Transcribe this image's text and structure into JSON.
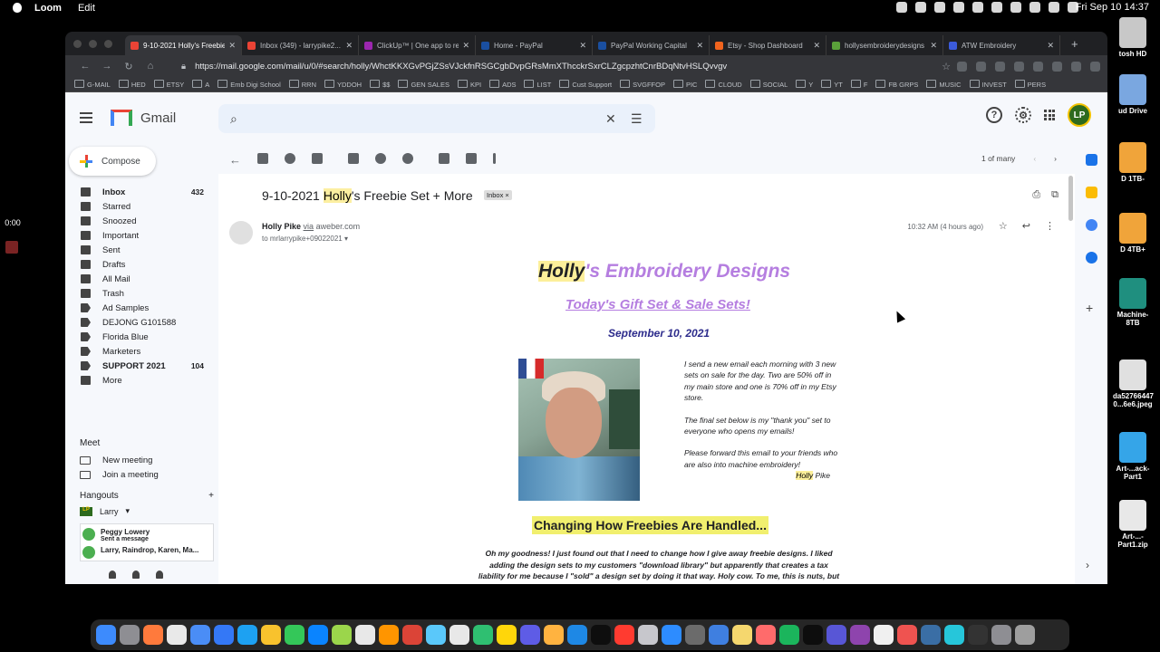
{
  "menubar": {
    "app": "Loom",
    "menu_edit": "Edit",
    "clock": "Fri Sep 10  14:37"
  },
  "loom": {
    "timer": "0:00"
  },
  "desktop_icons": [
    {
      "label": "tosh HD",
      "color": "#c8c8c8"
    },
    {
      "label": "ud Drive",
      "color": "#7aa7e0"
    },
    {
      "label": "D 1TB-",
      "color": "#f0a43a"
    },
    {
      "label": "D 4TB+",
      "color": "#f0a43a"
    },
    {
      "label": "Machine-8TB",
      "color": "#1f8f7f"
    },
    {
      "label": "da52766447 0...6e6.jpeg",
      "color": "#e0e0e0"
    },
    {
      "label": "Art-...ack-Part1",
      "color": "#35a5e8"
    },
    {
      "label": "Art-...-Part1.zip",
      "color": "#e8e8e8"
    }
  ],
  "browser": {
    "tabs": [
      {
        "title": "9-10-2021 Holly's Freebie",
        "color": "#ea4335",
        "active": true
      },
      {
        "title": "Inbox (349) - larrypike2...",
        "color": "#ea4335"
      },
      {
        "title": "ClickUp™ | One app to rep",
        "color": "#9c27b0"
      },
      {
        "title": "Home - PayPal",
        "color": "#1a4fa0"
      },
      {
        "title": "PayPal Working Capital",
        "color": "#1a4fa0"
      },
      {
        "title": "Etsy - Shop Dashboard",
        "color": "#f1641e"
      },
      {
        "title": "hollysembroiderydesigns",
        "color": "#5aa03a"
      },
      {
        "title": "ATW Embroidery",
        "color": "#3b5bdb"
      }
    ],
    "new_tab": "+",
    "url": "https://mail.google.com/mail/u/0/#search/holly/WhctKKXGvPGjZSsVJckfnRSGCgbDvpGRsMmXThcckrSxrCLZgcpzhtCnrBDqNtvHSLQvvgv",
    "bookmarks": [
      "G-MAIL",
      "HED",
      "ETSY",
      "A",
      "Emb Digi School",
      "RRN",
      "YDDOH",
      "$$",
      "GEN SALES",
      "KPI",
      "ADS",
      "LIST",
      "Cust Support",
      "SVGFFOP",
      "PIC",
      "CLOUD",
      "SOCIAL",
      "Y",
      "YT",
      "F",
      "FB GRPS",
      "MUSIC",
      "INVEST",
      "PERS"
    ]
  },
  "gmail": {
    "product": "Gmail",
    "search_value": "",
    "avatar_initials": "LP",
    "compose": "Compose",
    "nav": [
      {
        "label": "Inbox",
        "count": "432",
        "bold": true,
        "icon": "inbox-icon"
      },
      {
        "label": "Starred",
        "icon": "star-icon"
      },
      {
        "label": "Snoozed",
        "icon": "clock-icon"
      },
      {
        "label": "Important",
        "icon": "important-icon"
      },
      {
        "label": "Sent",
        "icon": "send-icon"
      },
      {
        "label": "Drafts",
        "icon": "draft-icon"
      },
      {
        "label": "All Mail",
        "icon": "all-mail-icon"
      },
      {
        "label": "Trash",
        "icon": "trash-icon"
      },
      {
        "label": "Ad Samples",
        "icon": "label-icon"
      },
      {
        "label": "DEJONG G101588",
        "icon": "label-icon"
      },
      {
        "label": "Florida Blue",
        "icon": "label-icon"
      },
      {
        "label": "Marketers",
        "icon": "label-icon"
      },
      {
        "label": "SUPPORT 2021",
        "count": "104",
        "bold": true,
        "icon": "label-icon"
      },
      {
        "label": "More",
        "icon": "chevron-down-icon"
      }
    ],
    "meet": {
      "title": "Meet",
      "new_meeting": "New meeting",
      "join_meeting": "Join a meeting"
    },
    "hangouts": {
      "title": "Hangouts",
      "me": "Larry",
      "contacts": [
        {
          "name": "Peggy Lowery",
          "status": "Sent a message"
        },
        {
          "name": "Larry, Raindrop, Karen, Ma...",
          "status": ""
        }
      ]
    },
    "pager": "1 of many",
    "message": {
      "subject_pre": "9-10-2021 ",
      "subject_hl": "Holly",
      "subject_post": "'s Freebie Set + More",
      "label_chip": "Inbox ×",
      "sender_name": "Holly Pike",
      "sender_via": "via",
      "sender_domain": "aweber.com",
      "to": "to mrlarrypike+09022021",
      "time": "10:32 AM (4 hours ago)",
      "body": {
        "title_hl": "Holly",
        "title_rest": "'s Embroidery Designs",
        "subtitle": "Today's Gift Set & Sale Sets!",
        "date": "September 10, 2021",
        "intro_1": "I send a new email each morning with 3 new sets on sale for the day.  Two are 50% off in my main store and one is 70% off in my Etsy store.",
        "intro_2": "The final set below is my \"thank you\" set to everyone who opens my emails!",
        "intro_3": "Please forward this email to your friends who are also into machine embroidery!",
        "sig_hl": "Holly",
        "sig_rest": " Pike",
        "heading": "Changing How Freebies Are Handled...",
        "para": "Oh my goodness!  I just found out that I need to change how I give away freebie designs.  I liked adding the design sets to my customers \"download library\" but apparently that creates a tax liability for me because I \"sold\" a design set by doing it that way.  Holy cow.  To me, this is nuts, but I don't get to run the world."
      }
    }
  },
  "dock_colors": [
    "#3d8bfd",
    "#8e8e93",
    "#ff7a3c",
    "#e9e9e9",
    "#4a8df6",
    "#3478f6",
    "#1da1f2",
    "#f8c22d",
    "#34c759",
    "#0a84ff",
    "#9bd64b",
    "#e8e8e8",
    "#ff9500",
    "#db4437",
    "#5ac8fa",
    "#e8e8e8",
    "#2fbf71",
    "#ffd60a",
    "#5e5ce6",
    "#ffb340",
    "#1e88e5",
    "#0e0e0e",
    "#ff3b30",
    "#c7c7cc",
    "#2d8cff",
    "#6b6b6b",
    "#3f7fe0",
    "#f5d76e",
    "#ff6b6b",
    "#1bb55c",
    "#0d0d0d",
    "#5856d6",
    "#8e44ad",
    "#f0f0f0",
    "#ef5350",
    "#3a6ea5",
    "#26c6da",
    "#333333",
    "#8e8e93",
    "#9e9e9e"
  ]
}
